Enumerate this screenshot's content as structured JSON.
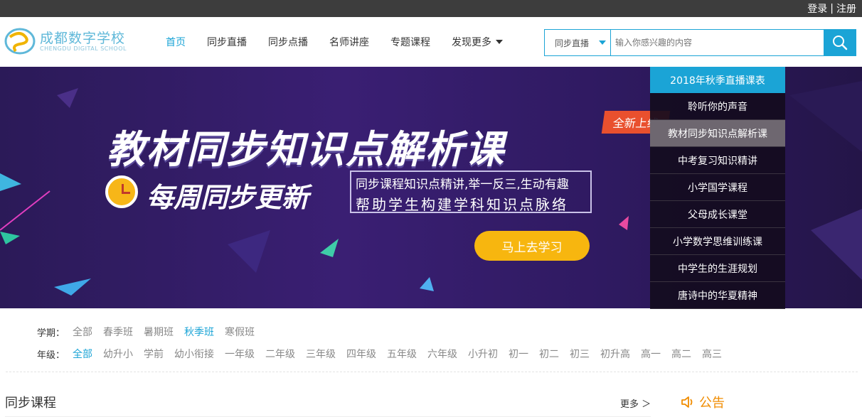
{
  "topbar": {
    "login": "登录",
    "separator": "|",
    "register": "注册"
  },
  "logo": {
    "name_cn": "成都数字学校",
    "name_en": "CHENGDU DIGITAL SCHOOL"
  },
  "nav": {
    "items": [
      {
        "label": "首页",
        "active": true
      },
      {
        "label": "同步直播"
      },
      {
        "label": "同步点播"
      },
      {
        "label": "名师讲座"
      },
      {
        "label": "专题课程"
      },
      {
        "label": "发现更多"
      }
    ]
  },
  "search": {
    "category": "同步直播",
    "placeholder": "输入你感兴趣的内容"
  },
  "banner": {
    "title": "教材同步知识点解析课",
    "badge": "全新上线",
    "subtitle": "每周同步更新",
    "desc_line1": "同步课程知识点精讲,举一反三,生动有趣",
    "desc_line2": "帮助学生构建学科知识点脉络",
    "cta": "马上去学习"
  },
  "side_menu": {
    "header": "2018年秋季直播课表",
    "items": [
      {
        "label": "聆听你的声音"
      },
      {
        "label": "教材同步知识点解析课",
        "highlight": true
      },
      {
        "label": "中考复习知识精讲"
      },
      {
        "label": "小学国学课程"
      },
      {
        "label": "父母成长课堂"
      },
      {
        "label": "小学数学思维训练课"
      },
      {
        "label": "中学生的生涯规划"
      },
      {
        "label": "唐诗中的华夏精神"
      }
    ]
  },
  "filters": {
    "term": {
      "label": "学期：",
      "options": [
        "全部",
        "春季班",
        "暑期班",
        "秋季班",
        "寒假班"
      ],
      "active_index": 3
    },
    "grade": {
      "label": "年级：",
      "options": [
        "全部",
        "幼升小",
        "学前",
        "幼小衔接",
        "一年级",
        "二年级",
        "三年级",
        "四年级",
        "五年级",
        "六年级",
        "小升初",
        "初一",
        "初二",
        "初三",
        "初升高",
        "高一",
        "高二",
        "高三"
      ],
      "active_index": 0
    }
  },
  "section": {
    "title": "同步课程",
    "more": "更多 ＞"
  },
  "notice": {
    "title": "公告"
  },
  "colors": {
    "accent": "#1ba4d6",
    "cta": "#f7b60f",
    "badge": "#e9502e",
    "notice": "#f08c00"
  }
}
